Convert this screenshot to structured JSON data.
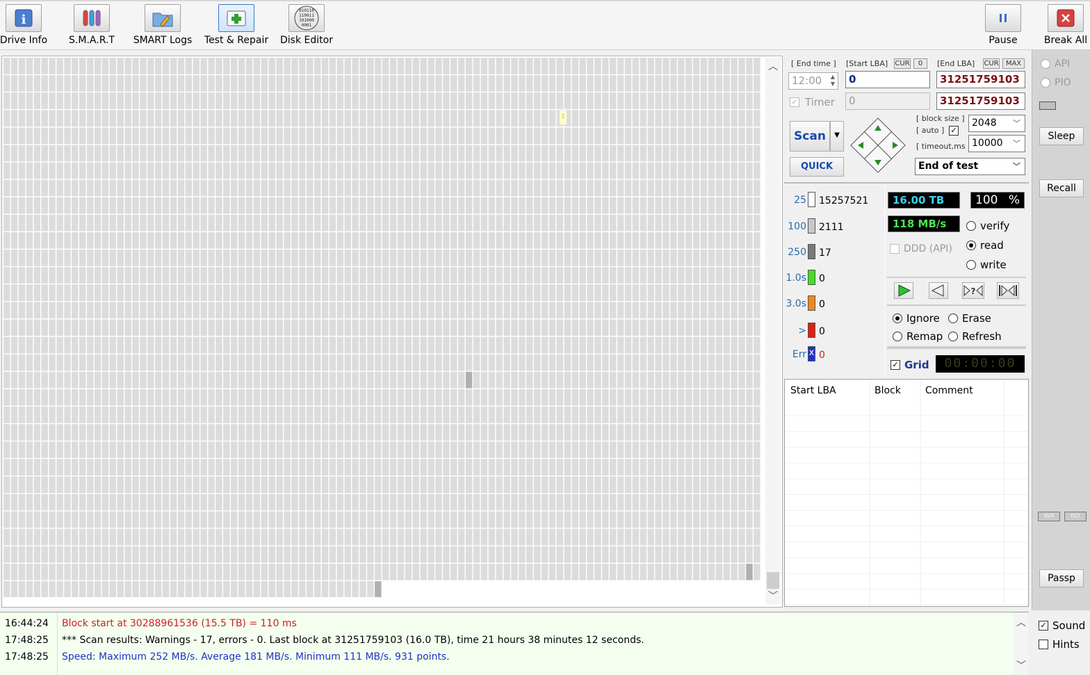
{
  "toolbar": {
    "drive_info": "Drive Info",
    "smart": "S.M.A.R.T",
    "smart_logs": "SMART Logs",
    "test_repair": "Test & Repair",
    "disk_editor": "Disk Editor",
    "pause": "Pause",
    "break_all": "Break All",
    "disk_editor_icon_text": "010110\n110011\n101000\n0001"
  },
  "map": {
    "block_marker": "1"
  },
  "panel": {
    "end_time_label": "[ End time ]",
    "end_time_value": "12:00",
    "timer_label": "Timer",
    "timer_value": "0",
    "start_lba_label": "[Start LBA]",
    "start_lba_cur": "CUR",
    "start_lba_zero": "0",
    "start_lba_value": "0",
    "end_lba_label": "[End LBA]",
    "end_lba_cur": "CUR",
    "end_lba_max": "MAX",
    "end_lba_value": "31251759103",
    "end_lba_value2": "31251759103",
    "block_size_label": "[ block size ]",
    "auto_label": "[ auto ]",
    "timeout_label": "[ timeout,ms ]",
    "block_size_value": "2048",
    "timeout_value": "10000",
    "scan_label": "Scan",
    "quick_label": "QUICK",
    "end_of_test": "End of test"
  },
  "legend": [
    {
      "label": "25",
      "count": "15257521",
      "color": "#ffffff"
    },
    {
      "label": "100",
      "count": "2111",
      "color": "#c8c8c8"
    },
    {
      "label": "250",
      "count": "17",
      "color": "#7a7a7a"
    },
    {
      "label": "1.0s",
      "count": "0",
      "color": "#44dd22"
    },
    {
      "label": "3.0s",
      "count": "0",
      "color": "#f08820"
    },
    {
      "label": ">",
      "count": "0",
      "color": "#e02010"
    },
    {
      "label": "Err",
      "count": "0",
      "color": "#2030d0"
    }
  ],
  "stats": {
    "capacity": "16.00 TB",
    "percent": "100",
    "percent_sign": "%",
    "speed": "118 MB/s",
    "ddd": "DDD (API)",
    "verify": "verify",
    "read": "read",
    "write": "write",
    "ignore": "Ignore",
    "erase": "Erase",
    "remap": "Remap",
    "refresh": "Refresh",
    "grid": "Grid",
    "clock": "00:00:00",
    "err_mark": "x"
  },
  "badtable": {
    "col_start": "Start LBA",
    "col_block": "Block",
    "col_comment": "Comment"
  },
  "farright": {
    "api": "API",
    "pio": "PIO",
    "sleep": "Sleep",
    "recall": "Recall",
    "wr": "WR",
    "rd": "RD",
    "passp": "Passp"
  },
  "log": [
    {
      "time": "16:44:24",
      "msg": "Block start at 30288961536 (15.5 TB)  = 110 ms",
      "color": "#d02020"
    },
    {
      "time": "17:48:25",
      "msg": "*** Scan results: Warnings - 17, errors - 0. Last block at 31251759103 (16.0 TB), time 21 hours 38 minutes 12 seconds.",
      "color": "#000000"
    },
    {
      "time": "17:48:25",
      "msg": "Speed: Maximum 252 MB/s. Average 181 MB/s. Minimum 111 MB/s. 931 points.",
      "color": "#1c34c8"
    }
  ],
  "bottomright": {
    "sound": "Sound",
    "hints": "Hints"
  }
}
